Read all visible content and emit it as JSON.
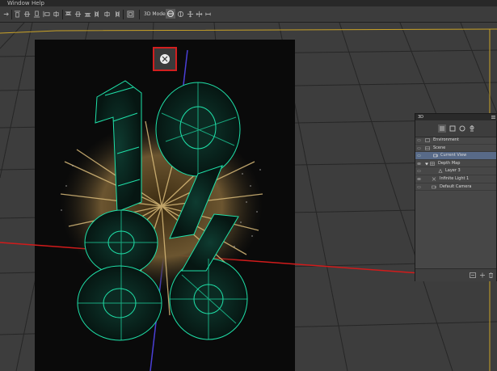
{
  "menu": {
    "items": [
      "Window",
      "Help"
    ]
  },
  "toolbar": {
    "mode_label": "3D Mode:"
  },
  "panel": {
    "tab_label": "3D",
    "layers": [
      {
        "label": "Environment",
        "indent": 0,
        "selected": false
      },
      {
        "label": "Scene",
        "indent": 0,
        "selected": false
      },
      {
        "label": "Current View",
        "indent": 1,
        "selected": true
      },
      {
        "label": "Depth Map",
        "indent": 1,
        "selected": false
      },
      {
        "label": "Layer 3",
        "indent": 2,
        "selected": false
      },
      {
        "label": "Infinite Light 1",
        "indent": 1,
        "selected": false
      },
      {
        "label": "Default Camera",
        "indent": 1,
        "selected": false
      }
    ]
  },
  "colors": {
    "selection_highlight": "#d21f1f",
    "x_axis": "#d21b1b",
    "y_axis": "#4a3fd6",
    "wireframe": "#1fe0a8",
    "canvas_border": "#c9a227",
    "selected_row": "#586a88"
  }
}
